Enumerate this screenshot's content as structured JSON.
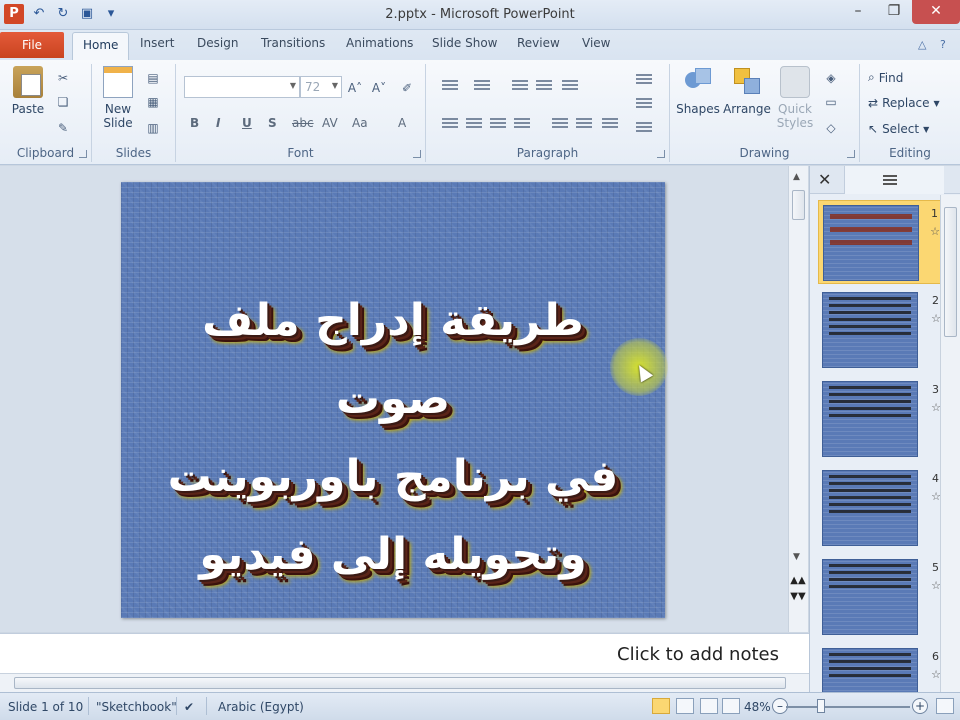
{
  "window": {
    "title": "2.pptx - Microsoft PowerPoint",
    "app_icon": "P",
    "controls": [
      "minimize-icon",
      "maximize-icon",
      "close-icon"
    ]
  },
  "quick_access": [
    "undo-icon",
    "redo-icon",
    "save-icon",
    "customize-icon"
  ],
  "tabs": [
    {
      "label": "File"
    },
    {
      "label": "Home",
      "active": true
    },
    {
      "label": "Insert"
    },
    {
      "label": "Design"
    },
    {
      "label": "Transitions"
    },
    {
      "label": "Animations"
    },
    {
      "label": "Slide Show"
    },
    {
      "label": "Review"
    },
    {
      "label": "View"
    }
  ],
  "ribbon": {
    "clipboard": {
      "label": "Clipboard",
      "paste": "Paste"
    },
    "slides": {
      "label": "Slides",
      "new_slide_line1": "New",
      "new_slide_line2": "Slide"
    },
    "font": {
      "label": "Font",
      "size": "72",
      "buttons": [
        "B",
        "I",
        "U",
        "S",
        "abc",
        "AV",
        "Aa",
        "A"
      ]
    },
    "paragraph": {
      "label": "Paragraph"
    },
    "drawing": {
      "label": "Drawing",
      "shapes": "Shapes",
      "arrange": "Arrange",
      "quick_styles_line1": "Quick",
      "quick_styles_line2": "Styles"
    },
    "editing": {
      "label": "Editing",
      "find": "Find",
      "replace": "Replace",
      "select": "Select"
    }
  },
  "slide": {
    "title_lines": [
      "طريقة إدراج ملف صوت",
      "في برنامج باوربوينت",
      "وتحويله إلى فيديو"
    ]
  },
  "thumbnails": [
    {
      "number": "1",
      "selected": true
    },
    {
      "number": "2"
    },
    {
      "number": "3"
    },
    {
      "number": "4"
    },
    {
      "number": "5"
    },
    {
      "number": "6"
    }
  ],
  "notes": {
    "placeholder": "Click to add notes"
  },
  "statusbar": {
    "slide_info": "Slide 1 of 10",
    "theme": "\"Sketchbook\"",
    "language": "Arabic (Egypt)",
    "zoom": "48%"
  },
  "colors": {
    "file_tab": "#d24726",
    "slide_bg": "#5a7ab6",
    "selected_thumb": "#fbd772"
  }
}
